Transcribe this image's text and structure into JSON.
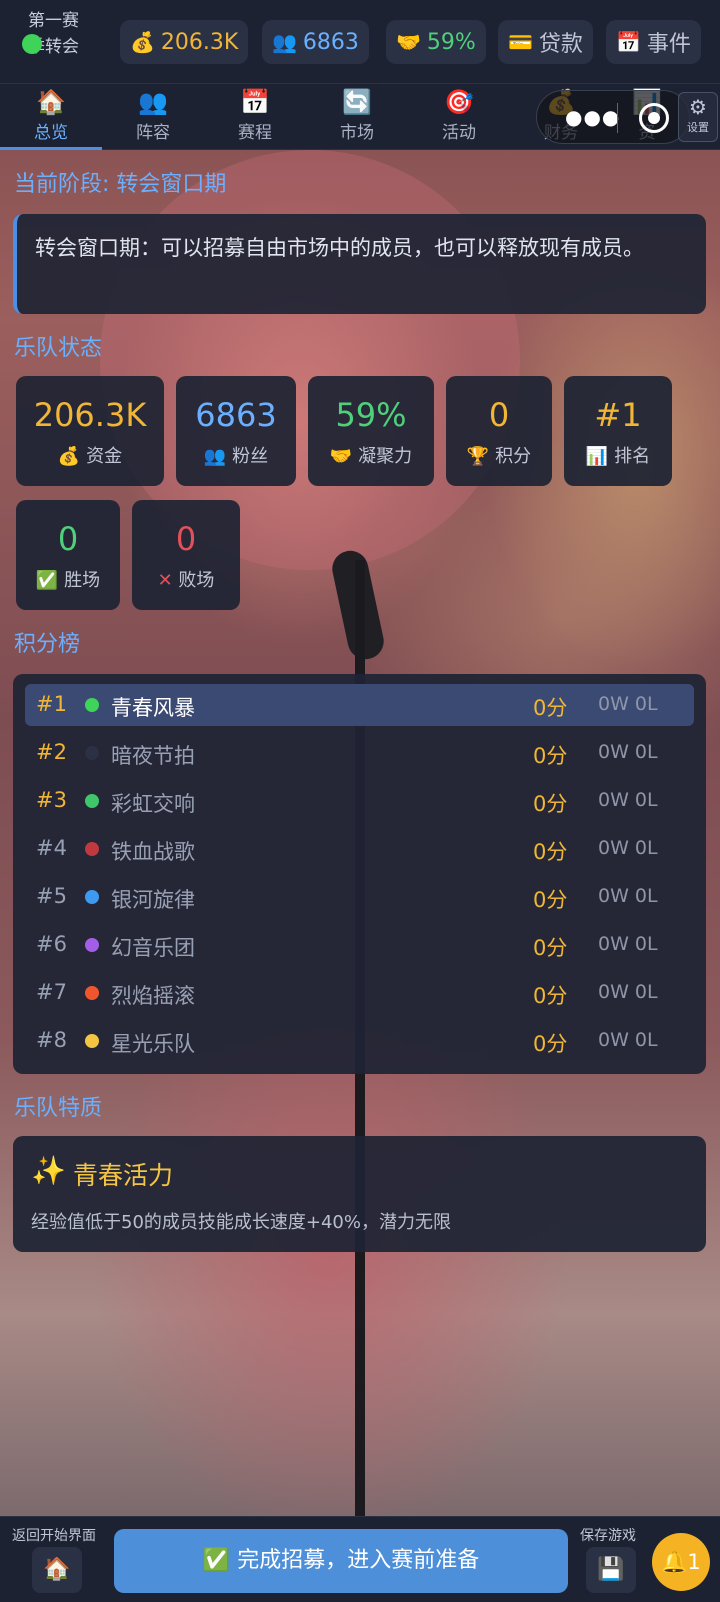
{
  "colors": {
    "accent": "#4a8fe8",
    "gold": "#f2b636",
    "green": "#3fd35a",
    "red": "#e2515a",
    "panel": "#1e2434"
  },
  "topbar": {
    "season": "第一赛季转会",
    "money": {
      "icon": "money-bag-icon",
      "value": "206.3K"
    },
    "fans": {
      "icon": "fans-icon",
      "value": "6863"
    },
    "cohesion": {
      "icon": "handshake-icon",
      "value": "59%"
    },
    "loan": {
      "icon": "card-icon",
      "label": "贷款"
    },
    "events": {
      "icon": "calendar-icon",
      "label": "事件"
    }
  },
  "tabs": [
    {
      "label": "总览",
      "icon": "house-icon",
      "active": true
    },
    {
      "label": "阵容",
      "icon": "people-icon"
    },
    {
      "label": "赛程",
      "icon": "calendar-icon"
    },
    {
      "label": "市场",
      "icon": "refresh-icon"
    },
    {
      "label": "活动",
      "icon": "target-icon"
    },
    {
      "label": "财务",
      "icon": "money-bag-icon"
    },
    {
      "label": "资",
      "icon": "chart-icon"
    }
  ],
  "settings_label": "设置",
  "phase": {
    "heading": "当前阶段: 转会窗口期",
    "description": "转会窗口期：可以招募自由市场中的成员，也可以释放现有成员。"
  },
  "status": {
    "heading": "乐队状态",
    "cards": [
      {
        "value": "206.3K",
        "label": "资金",
        "icon": "money-bag-icon",
        "color": "#f2b636"
      },
      {
        "value": "6863",
        "label": "粉丝",
        "icon": "fans-icon",
        "color": "#6ab0ff"
      },
      {
        "value": "59%",
        "label": "凝聚力",
        "icon": "handshake-icon",
        "color": "#4fd07a"
      },
      {
        "value": "0",
        "label": "积分",
        "icon": "trophy-icon",
        "color": "#f2b636"
      },
      {
        "value": "#1",
        "label": "排名",
        "icon": "bar-chart-icon",
        "color": "#f2b636"
      },
      {
        "value": "0",
        "label": "胜场",
        "icon": "check-icon",
        "color": "#4fd07a"
      },
      {
        "value": "0",
        "label": "败场",
        "icon": "cross-icon",
        "color": "#e2515a"
      }
    ]
  },
  "standings": {
    "heading": "积分榜",
    "rows": [
      {
        "rank": "#1",
        "name": "青春风暴",
        "points": "0分",
        "record": "0W 0L",
        "dot": "#3fd35a"
      },
      {
        "rank": "#2",
        "name": "暗夜节拍",
        "points": "0分",
        "record": "0W 0L",
        "dot": "#2b3044"
      },
      {
        "rank": "#3",
        "name": "彩虹交响",
        "points": "0分",
        "record": "0W 0L",
        "dot": "#3fc56a"
      },
      {
        "rank": "#4",
        "name": "铁血战歌",
        "points": "0分",
        "record": "0W 0L",
        "dot": "#c0393f"
      },
      {
        "rank": "#5",
        "name": "银河旋律",
        "points": "0分",
        "record": "0W 0L",
        "dot": "#3d9af0"
      },
      {
        "rank": "#6",
        "name": "幻音乐团",
        "points": "0分",
        "record": "0W 0L",
        "dot": "#a35ee8"
      },
      {
        "rank": "#7",
        "name": "烈焰摇滚",
        "points": "0分",
        "record": "0W 0L",
        "dot": "#f0562e"
      },
      {
        "rank": "#8",
        "name": "星光乐队",
        "points": "0分",
        "record": "0W 0L",
        "dot": "#f4c542"
      }
    ]
  },
  "trait": {
    "heading": "乐队特质",
    "icon": "sparkles-icon",
    "title": "青春活力",
    "description": "经验值低于50的成员技能成长速度+40%，潜力无限"
  },
  "bottom": {
    "back_label": "返回开始界面",
    "main_button": "完成招募，进入赛前准备",
    "save_label": "保存游戏",
    "notification_count": "1"
  }
}
